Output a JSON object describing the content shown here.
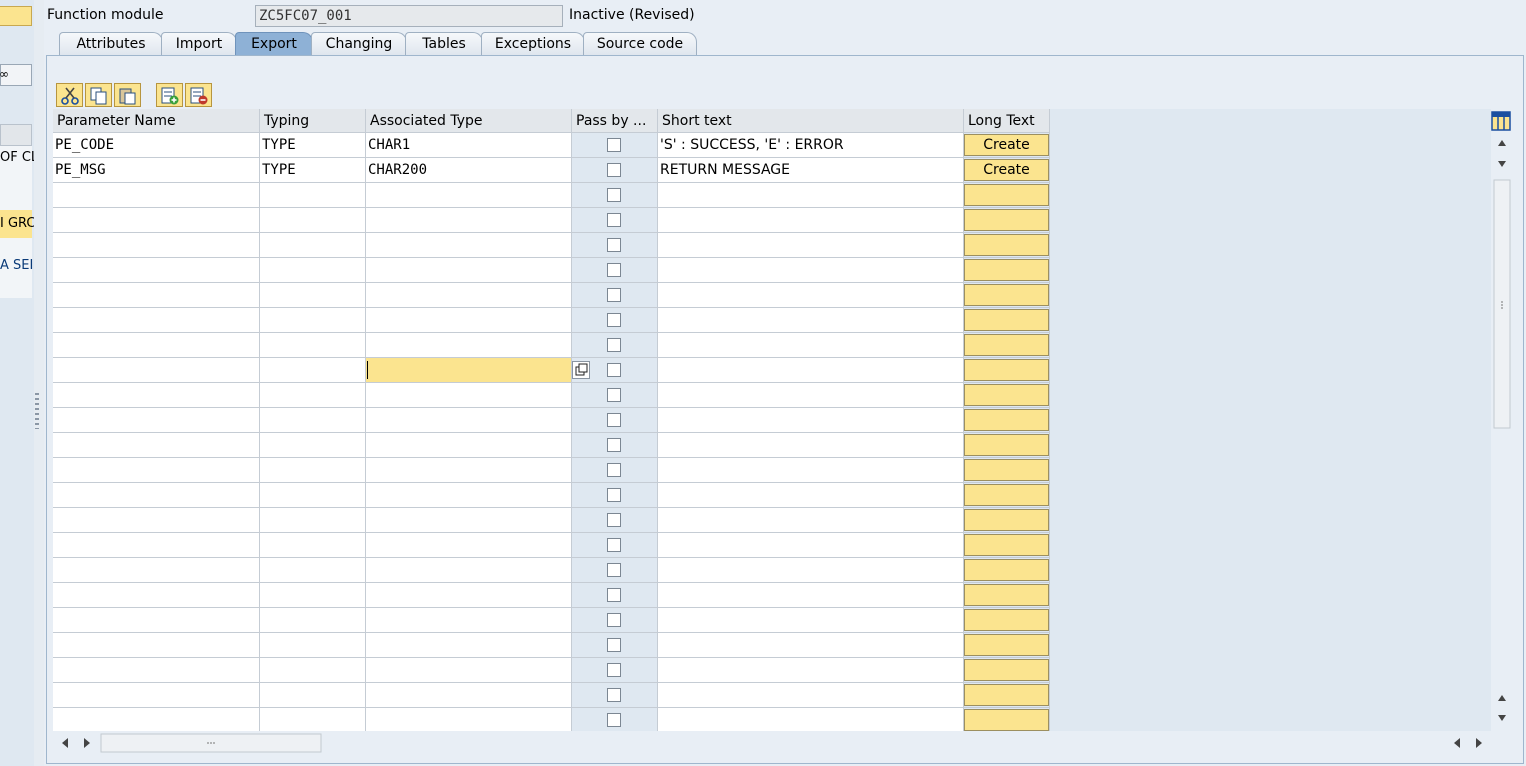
{
  "header": {
    "label": "Function module",
    "name": "ZC5FC07_001",
    "status": "Inactive (Revised)"
  },
  "left_panel": {
    "item1": "OF CL",
    "item2": "I GRC",
    "item3": "A SEI"
  },
  "tabs": [
    {
      "label": "Attributes",
      "active": false
    },
    {
      "label": "Import",
      "active": false
    },
    {
      "label": "Export",
      "active": true
    },
    {
      "label": "Changing",
      "active": false
    },
    {
      "label": "Tables",
      "active": false
    },
    {
      "label": "Exceptions",
      "active": false
    },
    {
      "label": "Source code",
      "active": false
    }
  ],
  "toolbar": [
    "cut-icon",
    "copy-icon",
    "paste-icon",
    "insert-row-icon",
    "delete-row-icon"
  ],
  "table": {
    "columns": [
      "Parameter Name",
      "Typing",
      "Associated Type",
      "Pass by ...",
      "Short text",
      "Long Text"
    ],
    "rows": [
      {
        "name": "PE_CODE",
        "typing": "TYPE",
        "assoc": "CHAR1",
        "short": "'S' : SUCCESS, 'E' : ERROR",
        "longtext": "Create"
      },
      {
        "name": "PE_MSG",
        "typing": "TYPE",
        "assoc": "CHAR200",
        "short": "RETURN MESSAGE",
        "longtext": "Create"
      }
    ],
    "empty_row_count": 23,
    "focused_empty_row": 9
  },
  "colors": {
    "accent_yellow": "#fbe48f",
    "tab_active": "#8eb1d6",
    "background": "#e8eef5"
  }
}
